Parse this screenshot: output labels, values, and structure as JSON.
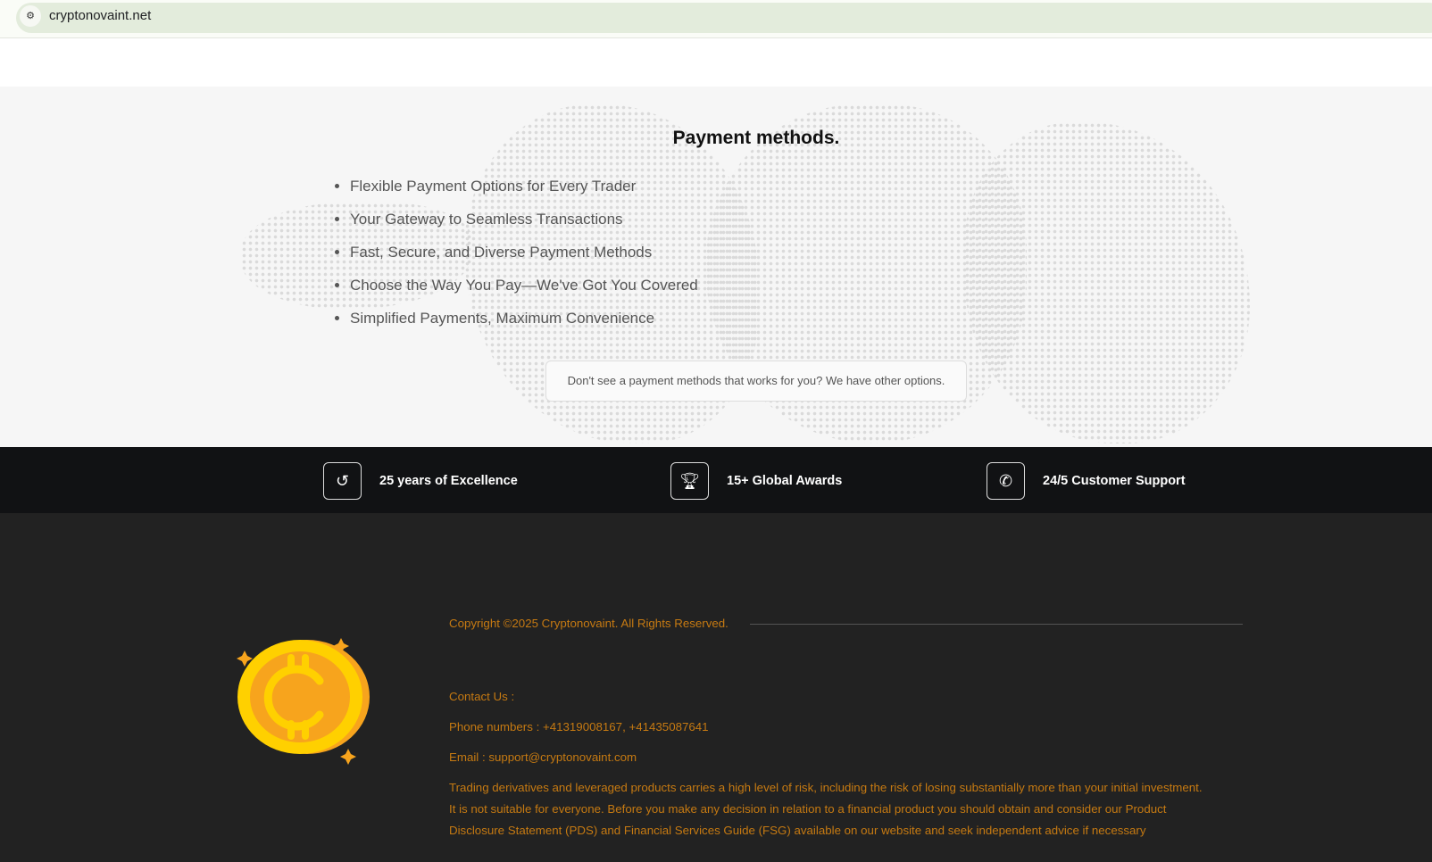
{
  "browser": {
    "url": "cryptonovaint.net",
    "site_info_icon": "tune-icon"
  },
  "payment": {
    "title": "Payment methods.",
    "items": [
      "Flexible Payment Options for Every Trader",
      "Your Gateway to Seamless Transactions",
      "Fast, Secure, and Diverse Payment Methods",
      "Choose the Way You Pay—We've Got You Covered",
      "Simplified Payments, Maximum Convenience"
    ],
    "other_options": "Don't see a payment methods that works for you? We have other options."
  },
  "features": [
    {
      "icon": "history-icon",
      "label": "25 years of Excellence"
    },
    {
      "icon": "trophy-icon",
      "label": "15+ Global Awards"
    },
    {
      "icon": "phone-icon",
      "label": "24/5 Customer Support"
    }
  ],
  "footer": {
    "copyright": "Copyright ©2025 Cryptonovaint. All Rights Reserved.",
    "contact_heading": "Contact Us :",
    "phones": "Phone numbers : +41319008167, +41435087641",
    "email": "Email : support@cryptonovaint.com",
    "disclaimer": [
      "Trading derivatives and leveraged products carries a high level of risk, including the risk of losing substantially more than your initial investment.",
      "It is not suitable for everyone. Before you make any decision in relation to a financial product you should obtain and consider our Product",
      "Disclosure Statement (PDS) and Financial Services Guide (FSG) available on our website and seek independent advice if necessary"
    ]
  },
  "colors": {
    "accent": "#c67a12",
    "band": "#111214",
    "footer": "#222222"
  }
}
